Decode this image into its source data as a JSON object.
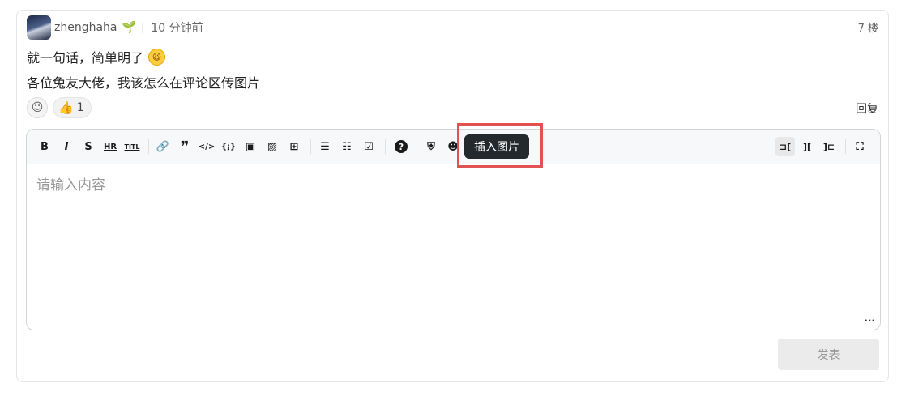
{
  "post": {
    "username": "zhenghaha",
    "time": "10 分钟前",
    "floor": "7 楼",
    "line1": "就一句话，简单明了",
    "line2": "各位兔友大佬，我该怎么在评论区传图片",
    "like_count": "1",
    "reply_label": "回复"
  },
  "editor": {
    "toolbar": [
      "B",
      "I",
      "S",
      "HR",
      "TITLE",
      "link",
      "quote",
      "code",
      "code-block",
      "comment",
      "image",
      "table",
      "ul",
      "ol",
      "checklist",
      "help",
      "shield",
      "emoji"
    ],
    "tooltip": "插入图片",
    "placeholder": "请输入内容",
    "submit_label": "发表"
  },
  "icons": {
    "user_badge": "sprout-icon",
    "emoji": "laughing-emoji-icon"
  },
  "colors": {
    "highlight_border": "#e35252",
    "tooltip_bg": "#24292e",
    "submit_bg": "#ebebeb"
  }
}
